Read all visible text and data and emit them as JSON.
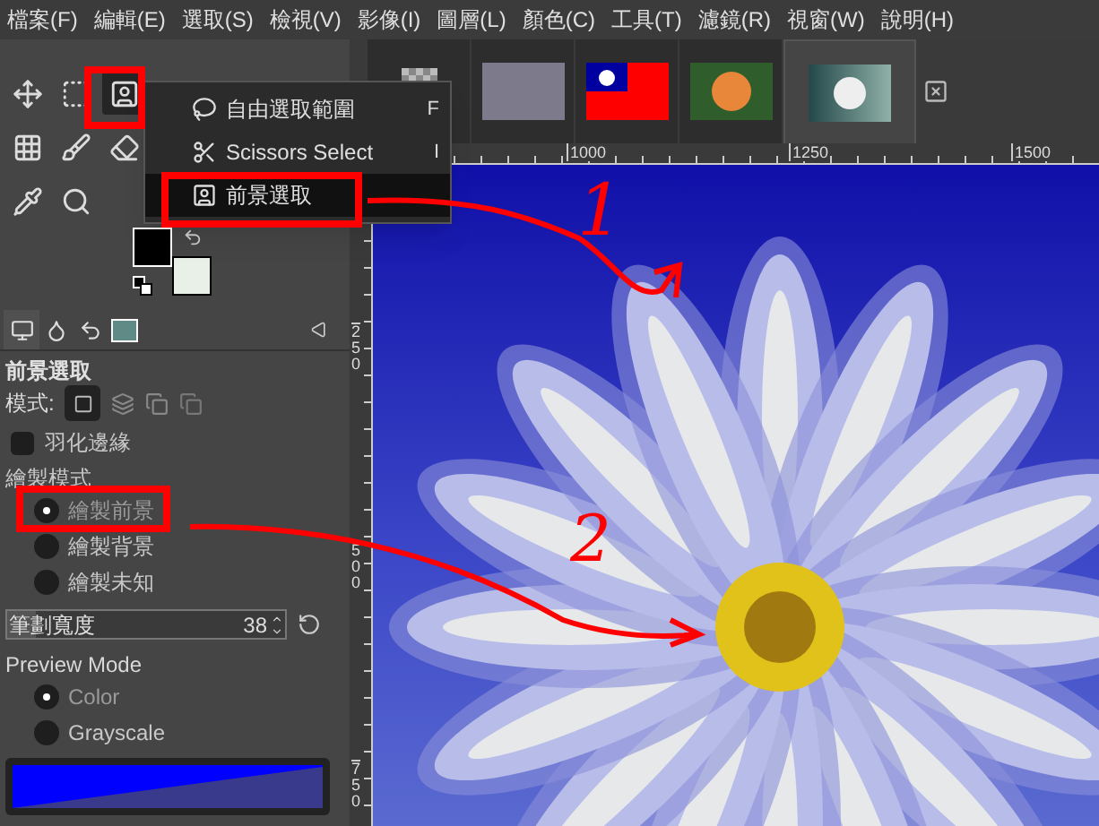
{
  "menu_bar": [
    "檔案(F)",
    "編輯(E)",
    "選取(S)",
    "檢視(V)",
    "影像(I)",
    "圖層(L)",
    "顏色(C)",
    "工具(T)",
    "濾鏡(R)",
    "視窗(W)",
    "說明(H)"
  ],
  "image_tabs": [
    {
      "kind": "figure",
      "selected": false
    },
    {
      "kind": "stones",
      "selected": false
    },
    {
      "kind": "flag",
      "selected": false
    },
    {
      "kind": "flower",
      "selected": false
    },
    {
      "kind": "daisy",
      "selected": true
    }
  ],
  "toolbox": {
    "tools": [
      {
        "kind": "move",
        "selected": false
      },
      {
        "kind": "rect",
        "selected": false
      },
      {
        "kind": "foreground",
        "selected": true
      },
      {
        "kind": "checker",
        "selected": false
      },
      {
        "kind": "brush",
        "selected": false
      },
      {
        "kind": "eraser",
        "selected": false
      },
      {
        "kind": "picker",
        "selected": false
      },
      {
        "kind": "zoom",
        "selected": false
      }
    ]
  },
  "tool_menu": {
    "items": [
      {
        "kind": "lasso",
        "label": "自由選取範圍",
        "shortcut": "F",
        "selected": false
      },
      {
        "kind": "scissors",
        "label": "Scissors Select",
        "shortcut": "I",
        "selected": false
      },
      {
        "kind": "foreground",
        "label": "前景選取",
        "selected": true
      }
    ]
  },
  "tool_options": {
    "title": "前景選取",
    "mode_label": "模式:",
    "feather": {
      "label": "羽化邊緣",
      "checked": false
    },
    "draw_mode": {
      "label": "繪製模式",
      "options": [
        {
          "label": "繪製前景",
          "selected": true
        },
        {
          "label": "繪製背景",
          "selected": false
        },
        {
          "label": "繪製未知",
          "selected": false
        }
      ]
    },
    "stroke_width": {
      "label": "筆劃寬度",
      "value": "38",
      "level": 0.1
    },
    "preview_mode": {
      "label": "Preview Mode",
      "options": [
        {
          "label": "Color",
          "selected": true
        },
        {
          "label": "Grayscale",
          "selected": false
        }
      ]
    }
  },
  "rulers": {
    "horizontal": [
      "1000",
      "1250",
      "1500"
    ],
    "vertical": [
      "250",
      "500",
      "750"
    ]
  },
  "annotations": [
    {
      "label": "1"
    },
    {
      "label": "2"
    }
  ]
}
